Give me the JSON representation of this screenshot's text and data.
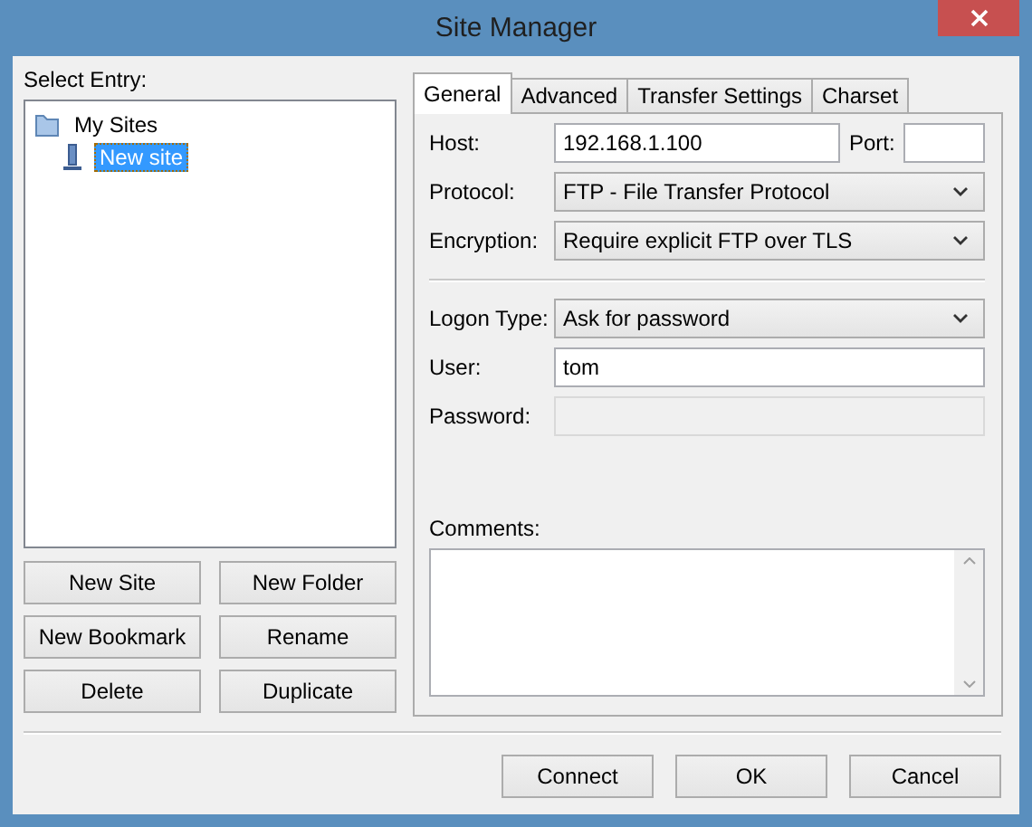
{
  "window": {
    "title": "Site Manager"
  },
  "select_entry_label": "Select Entry:",
  "tree": [
    {
      "label": "My Sites",
      "kind": "folder",
      "selected": false,
      "children": [
        {
          "label": "New site",
          "kind": "site",
          "selected": true
        }
      ]
    }
  ],
  "entry_buttons": [
    "New Site",
    "New Folder",
    "New Bookmark",
    "Rename",
    "Delete",
    "Duplicate"
  ],
  "tabs": [
    {
      "label": "General",
      "selected": true
    },
    {
      "label": "Advanced",
      "selected": false
    },
    {
      "label": "Transfer Settings",
      "selected": false
    },
    {
      "label": "Charset",
      "selected": false
    }
  ],
  "host": {
    "label": "Host:",
    "value": "192.168.1.100"
  },
  "port": {
    "label": "Port:"
  },
  "connection_fields": [
    {
      "kind": "select",
      "label": "Protocol:",
      "value": "FTP - File Transfer Protocol"
    },
    {
      "kind": "select",
      "label": "Encryption:",
      "value": "Require explicit FTP over TLS"
    }
  ],
  "logon_fields": [
    {
      "kind": "select",
      "label": "Logon Type:",
      "value": "Ask for password",
      "disabled": false
    },
    {
      "kind": "text",
      "label": "User:",
      "value": "tom",
      "disabled": false
    },
    {
      "kind": "text",
      "label": "Password:",
      "disabled": true
    }
  ],
  "comments": {
    "label": "Comments:"
  },
  "dialog_buttons": [
    "Connect",
    "OK",
    "Cancel"
  ]
}
